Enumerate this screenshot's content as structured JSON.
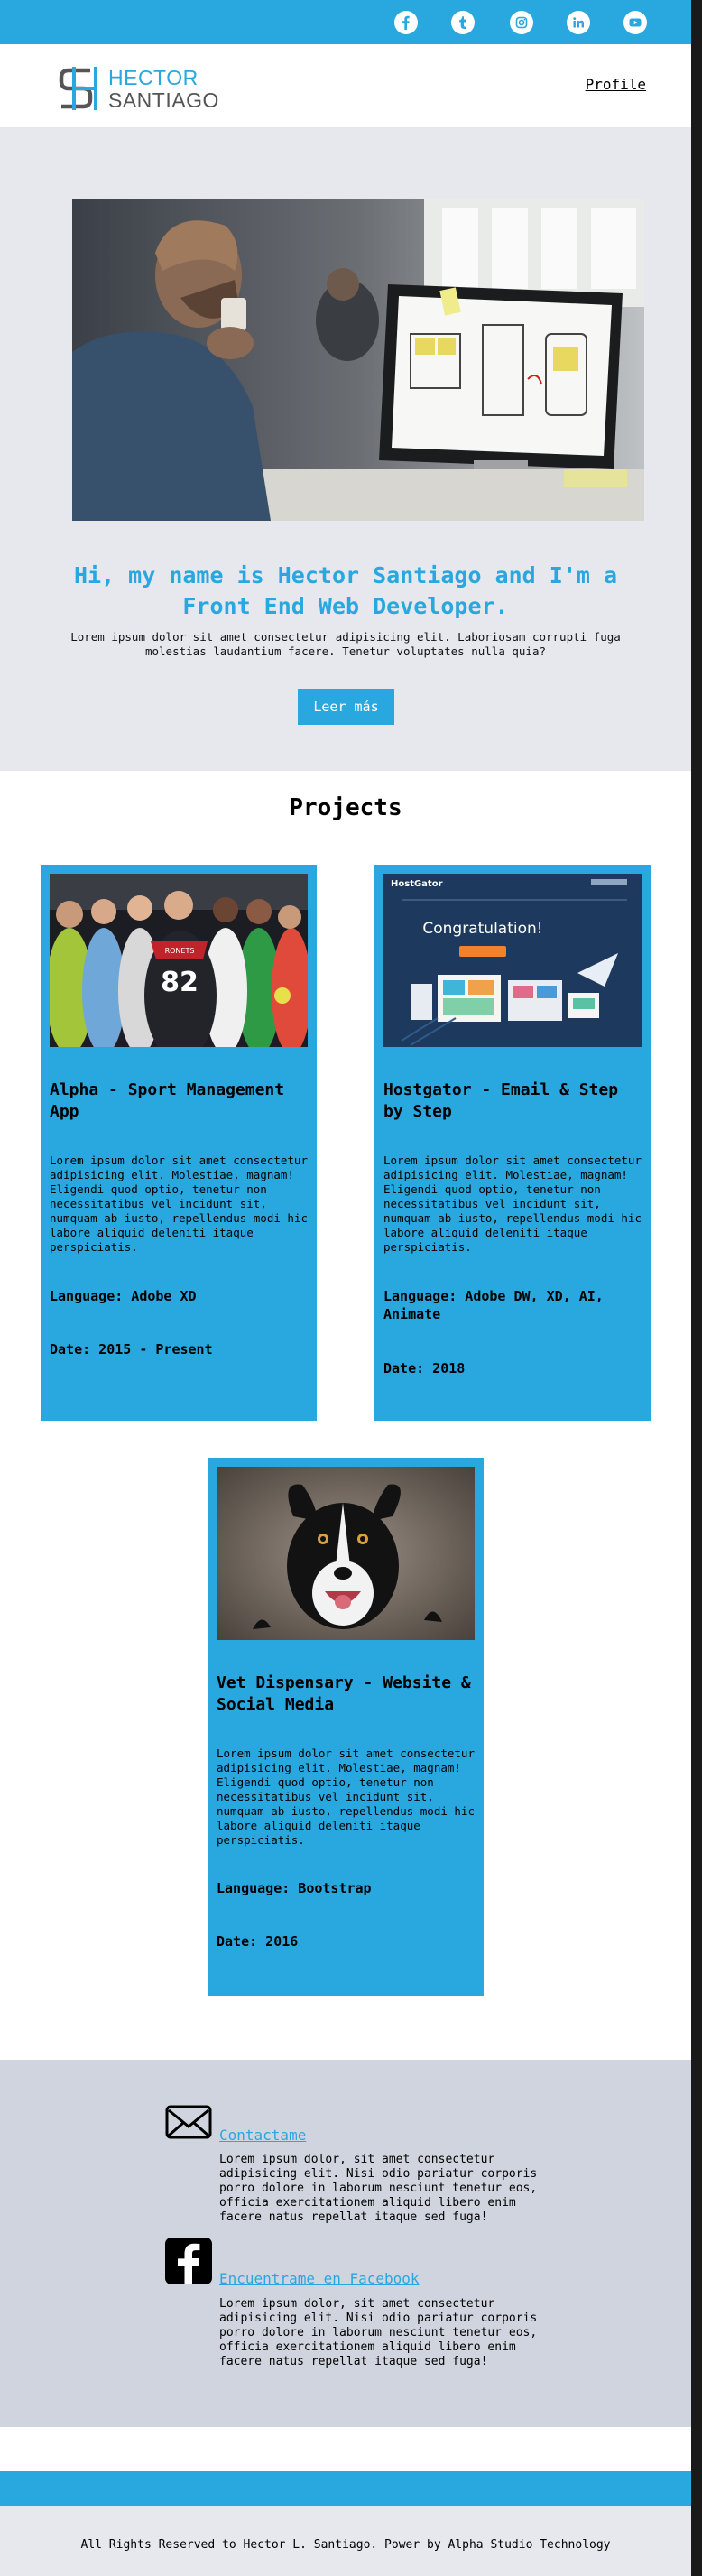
{
  "social": {
    "icons": [
      "facebook-icon",
      "tumblr-icon",
      "instagram-icon",
      "linkedin-icon",
      "youtube-icon"
    ],
    "accent": "#29a8e0"
  },
  "header": {
    "logo_line1": "HECTOR",
    "logo_line2": "SANTIAGO",
    "nav_profile": "Profile"
  },
  "hero": {
    "title": "Hi, my name is Hector Santiago and I'm a Front End Web Developer.",
    "text": "Lorem ipsum dolor sit amet consectetur adipisicing elit. Laboriosam corrupti fuga molestias laudantium facere. Tenetur voluptates nulla quia?",
    "button": "Leer más"
  },
  "projects": {
    "title": "Projects",
    "items": [
      {
        "title": "Alpha - Sport Management App",
        "desc": "Lorem ipsum dolor sit amet consectetur adipisicing elit. Molestiae, magnam! Eligendi quod optio, tenetur non necessitatibus vel incidunt sit, numquam ab iusto, repellendus modi hic labore aliquid deleniti itaque perspiciatis.",
        "language": "Language: Adobe XD",
        "date": "Date: 2015 - Present",
        "jersey": "82",
        "team": "RONETS"
      },
      {
        "title": "Hostgator - Email & Step by Step",
        "desc": "Lorem ipsum dolor sit amet consectetur adipisicing elit. Molestiae, magnam! Eligendi quod optio, tenetur non necessitatibus vel incidunt sit, numquam ab iusto, repellendus modi hic labore aliquid deleniti itaque perspiciatis.",
        "language": "Language: Adobe DW, XD, AI, Animate",
        "date": "Date: 2018",
        "brand": "HostGator",
        "headline": "Congratulation!"
      },
      {
        "title": "Vet Dispensary - Website & Social Media",
        "desc": "Lorem ipsum dolor sit amet consectetur adipisicing elit. Molestiae, magnam! Eligendi quod optio, tenetur non necessitatibus vel incidunt sit, numquam ab iusto, repellendus modi hic labore aliquid deleniti itaque perspiciatis.",
        "language": "Language: Bootstrap",
        "date": "Date: 2016"
      }
    ]
  },
  "contact": {
    "items": [
      {
        "link": "Contactame",
        "text": "Lorem ipsum dolor, sit amet consectetur adipisicing elit. Nisi odio pariatur corporis porro dolore in laborum nesciunt tenetur eos, officia exercitationem aliquid libero enim facere natus repellat itaque sed fuga!",
        "icon": "envelope-icon"
      },
      {
        "link": "Encuentrame en Facebook",
        "text": "Lorem ipsum dolor, sit amet consectetur adipisicing elit. Nisi odio pariatur corporis porro dolore in laborum nesciunt tenetur eos, officia exercitationem aliquid libero enim facere natus repellat itaque sed fuga!",
        "icon": "facebook-square-icon"
      }
    ]
  },
  "footer": {
    "text": "All Rights Reserved to Hector L. Santiago. Power by Alpha Studio Technology"
  }
}
